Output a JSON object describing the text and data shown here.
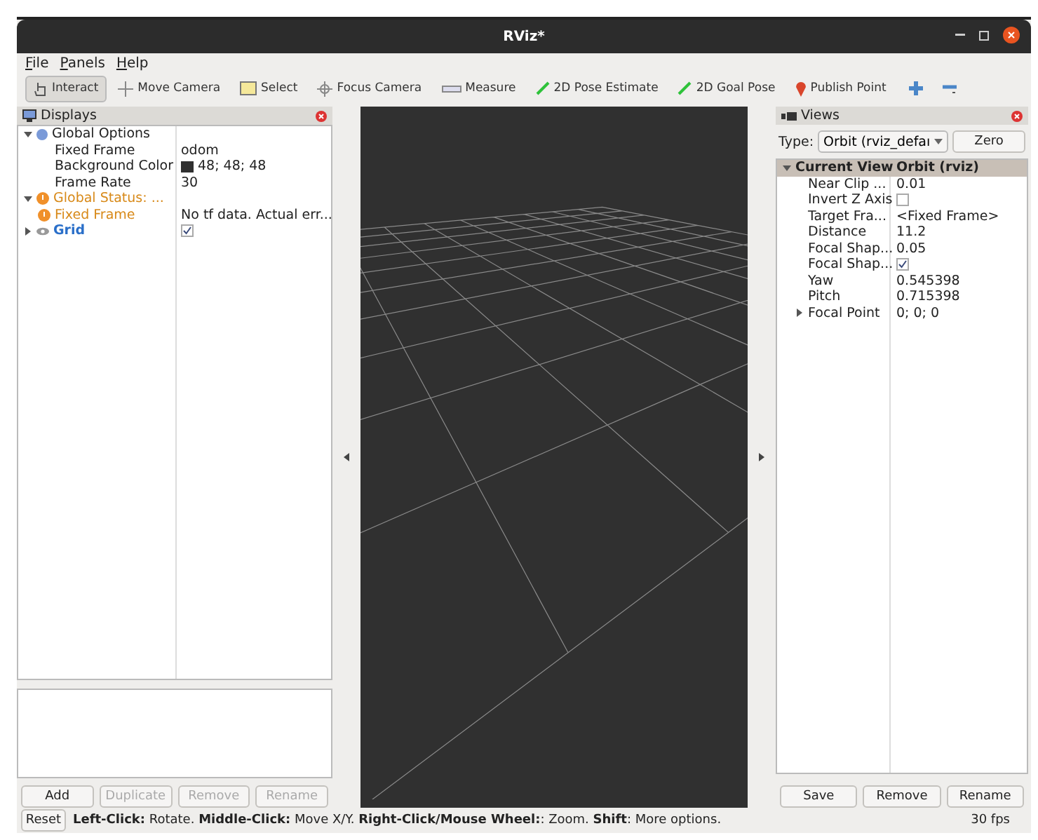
{
  "window": {
    "title": "RViz*"
  },
  "menu": [
    "File",
    "Panels",
    "Help"
  ],
  "toolbar": [
    {
      "label": "Interact",
      "selected": true
    },
    {
      "label": "Move Camera",
      "selected": false
    },
    {
      "label": "Select",
      "selected": false
    },
    {
      "label": "Focus Camera",
      "selected": false
    },
    {
      "label": "Measure",
      "selected": false
    },
    {
      "label": "2D Pose Estimate",
      "selected": false
    },
    {
      "label": "2D Goal Pose",
      "selected": false
    },
    {
      "label": "Publish Point",
      "selected": false
    }
  ],
  "displays": {
    "title": "Displays",
    "tree": [
      {
        "label": "Global Options",
        "kind": "options",
        "expanded": true,
        "children": [
          {
            "label": "Fixed Frame",
            "value": "odom"
          },
          {
            "label": "Background Color",
            "value": "48; 48; 48",
            "color": "#303030"
          },
          {
            "label": "Frame Rate",
            "value": "30"
          }
        ]
      },
      {
        "label": "Global Status: ...",
        "kind": "warning",
        "expanded": true,
        "children": [
          {
            "label": "Fixed Frame",
            "value": "No tf data.  Actual err...",
            "kind": "warning"
          }
        ]
      },
      {
        "label": "Grid",
        "kind": "display",
        "expanded": false,
        "checked": true
      }
    ],
    "buttons": [
      {
        "label": "Add",
        "disabled": false
      },
      {
        "label": "Duplicate",
        "disabled": true
      },
      {
        "label": "Remove",
        "disabled": true
      },
      {
        "label": "Rename",
        "disabled": true
      }
    ]
  },
  "views": {
    "title": "Views",
    "type_label": "Type:",
    "type_value": "Orbit (rviz_defaı",
    "zero": "Zero",
    "header": {
      "label": "Current View",
      "value": "Orbit (rviz)",
      "expanded": true,
      "selected": true
    },
    "properties": [
      {
        "label": "Near Clip ...",
        "value": "0.01"
      },
      {
        "label": "Invert Z Axis",
        "checked": false
      },
      {
        "label": "Target Fra...",
        "value": "<Fixed Frame>"
      },
      {
        "label": "Distance",
        "value": "11.2"
      },
      {
        "label": "Focal Shap...",
        "value": "0.05"
      },
      {
        "label": "Focal Shap...",
        "checked": true
      },
      {
        "label": "Yaw",
        "value": "0.545398"
      },
      {
        "label": "Pitch",
        "value": "0.715398"
      },
      {
        "label": "Focal Point",
        "value": "0; 0; 0",
        "expanded": false
      }
    ],
    "buttons": [
      "Save",
      "Remove",
      "Rename"
    ]
  },
  "status_bar": {
    "reset": "Reset",
    "hint": "**Left-Click:** Rotate. **Middle-Click:** Move X/Y. **Right-Click/Mouse Wheel:**: Zoom. **Shift**: More options.",
    "fps": "30 fps"
  }
}
